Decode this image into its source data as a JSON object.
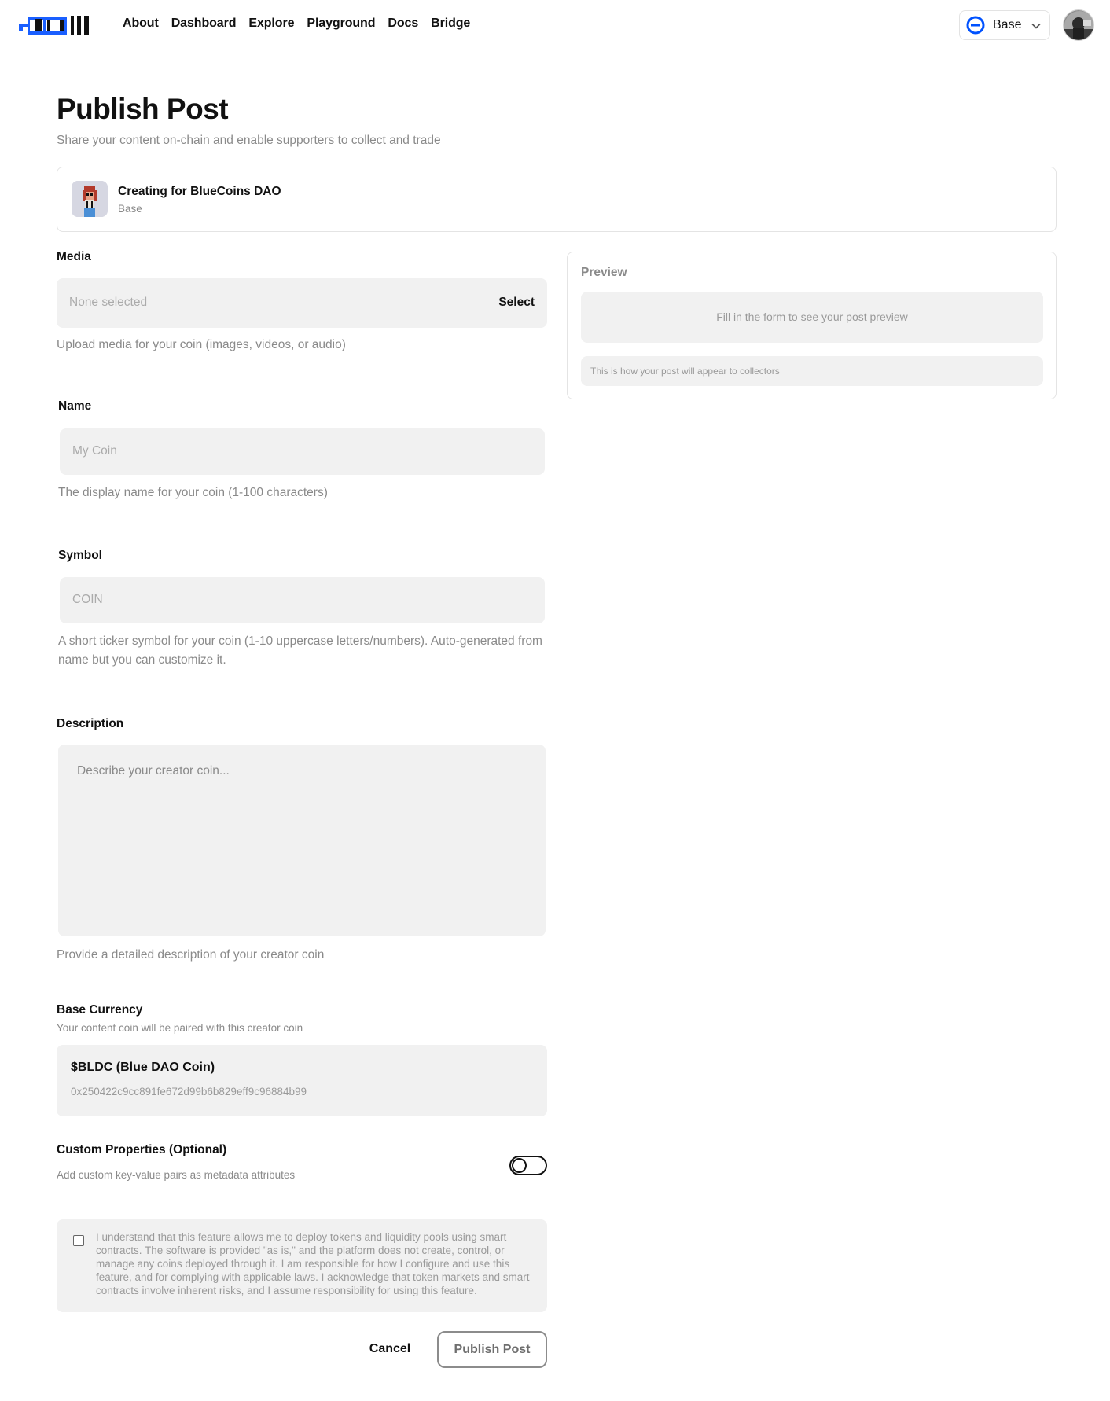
{
  "header": {
    "logo_icon": "brand-logo-icon",
    "nav": [
      "About",
      "Dashboard",
      "Explore",
      "Playground",
      "Docs",
      "Bridge"
    ],
    "chain": {
      "label": "Base",
      "icon": "base-chain-icon",
      "color": "#0052ff"
    },
    "avatar_icon": "user-avatar"
  },
  "page": {
    "title": "Publish Post",
    "subtitle": "Share your content on-chain and enable supporters to collect and trade"
  },
  "creator": {
    "title": "Creating for BlueCoins DAO",
    "chain": "Base"
  },
  "form": {
    "media": {
      "label": "Media",
      "placeholder": "None selected",
      "select_label": "Select",
      "help": "Upload media for your coin (images, videos, or audio)"
    },
    "name": {
      "label": "Name",
      "placeholder": "My Coin",
      "help": "The display name for your coin (1-100 characters)"
    },
    "symbol": {
      "label": "Symbol",
      "placeholder": "COIN",
      "help": "A short ticker symbol for your coin (1-10 uppercase letters/numbers). Auto-generated from name but you can customize it."
    },
    "description": {
      "label": "Description",
      "placeholder": "Describe your creator coin...",
      "help": "Provide a detailed description of your creator coin"
    },
    "base_currency": {
      "label": "Base Currency",
      "sublabel": "Your content coin will be paired with this creator coin",
      "name": "$BLDC (Blue DAO Coin)",
      "address": "0x250422c9cc891fe672d99b6b829eff9c96884b99"
    },
    "custom_properties": {
      "label": "Custom Properties (Optional)",
      "sublabel": "Add custom key-value pairs as metadata attributes",
      "enabled": false
    },
    "disclaimer": {
      "checked": false,
      "text": "I understand that this feature allows me to deploy tokens and liquidity pools using smart contracts. The software is provided \"as is,\" and the platform does not create, control, or manage any coins deployed through it. I am responsible for how I configure and use this feature, and for complying with applicable laws. I acknowledge that token markets and smart contracts involve inherent risks, and I assume responsibility for using this feature."
    },
    "cancel_label": "Cancel",
    "publish_label": "Publish Post"
  },
  "preview": {
    "title": "Preview",
    "empty_text": "Fill in the form to see your post preview",
    "note": "This is how your post will appear to collectors"
  }
}
